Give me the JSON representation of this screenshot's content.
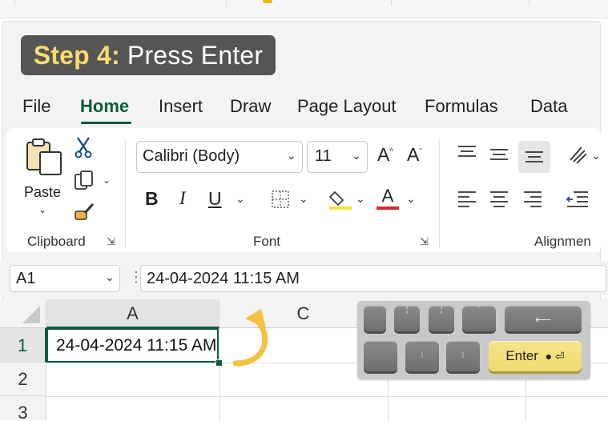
{
  "step_banner": {
    "prefix": "Step 4:",
    "text": "Press Enter"
  },
  "tabs": [
    {
      "label": "File"
    },
    {
      "label": "Home",
      "active": true
    },
    {
      "label": "Insert"
    },
    {
      "label": "Draw"
    },
    {
      "label": "Page Layout"
    },
    {
      "label": "Formulas"
    },
    {
      "label": "Data"
    }
  ],
  "clipboard": {
    "paste_label": "Paste",
    "group_label": "Clipboard"
  },
  "font": {
    "name": "Calibri (Body)",
    "size": "11",
    "group_label": "Font",
    "bold": "B",
    "italic": "I",
    "underline": "U",
    "grow": "A",
    "shrink": "A",
    "color_letter": "A",
    "highlight_color": "#f3e23a",
    "text_color": "#d42a2a"
  },
  "alignment": {
    "group_label": "Alignmen"
  },
  "name_box": {
    "value": "A1"
  },
  "formula_bar": {
    "value": "24-04-2024 11:15 AM"
  },
  "grid": {
    "columns": [
      "A",
      "C"
    ],
    "rows": [
      "1",
      "2",
      "3"
    ],
    "active_cell_value": "24-04-2024 11:15 AM"
  },
  "keyboard": {
    "enter_label": "Enter"
  },
  "colors": {
    "accent": "#0e5c3a",
    "banner_bg": "#555555",
    "banner_highlight": "#f7dc6f",
    "arrow": "#f5c342",
    "enter_key": "#f1df78"
  }
}
